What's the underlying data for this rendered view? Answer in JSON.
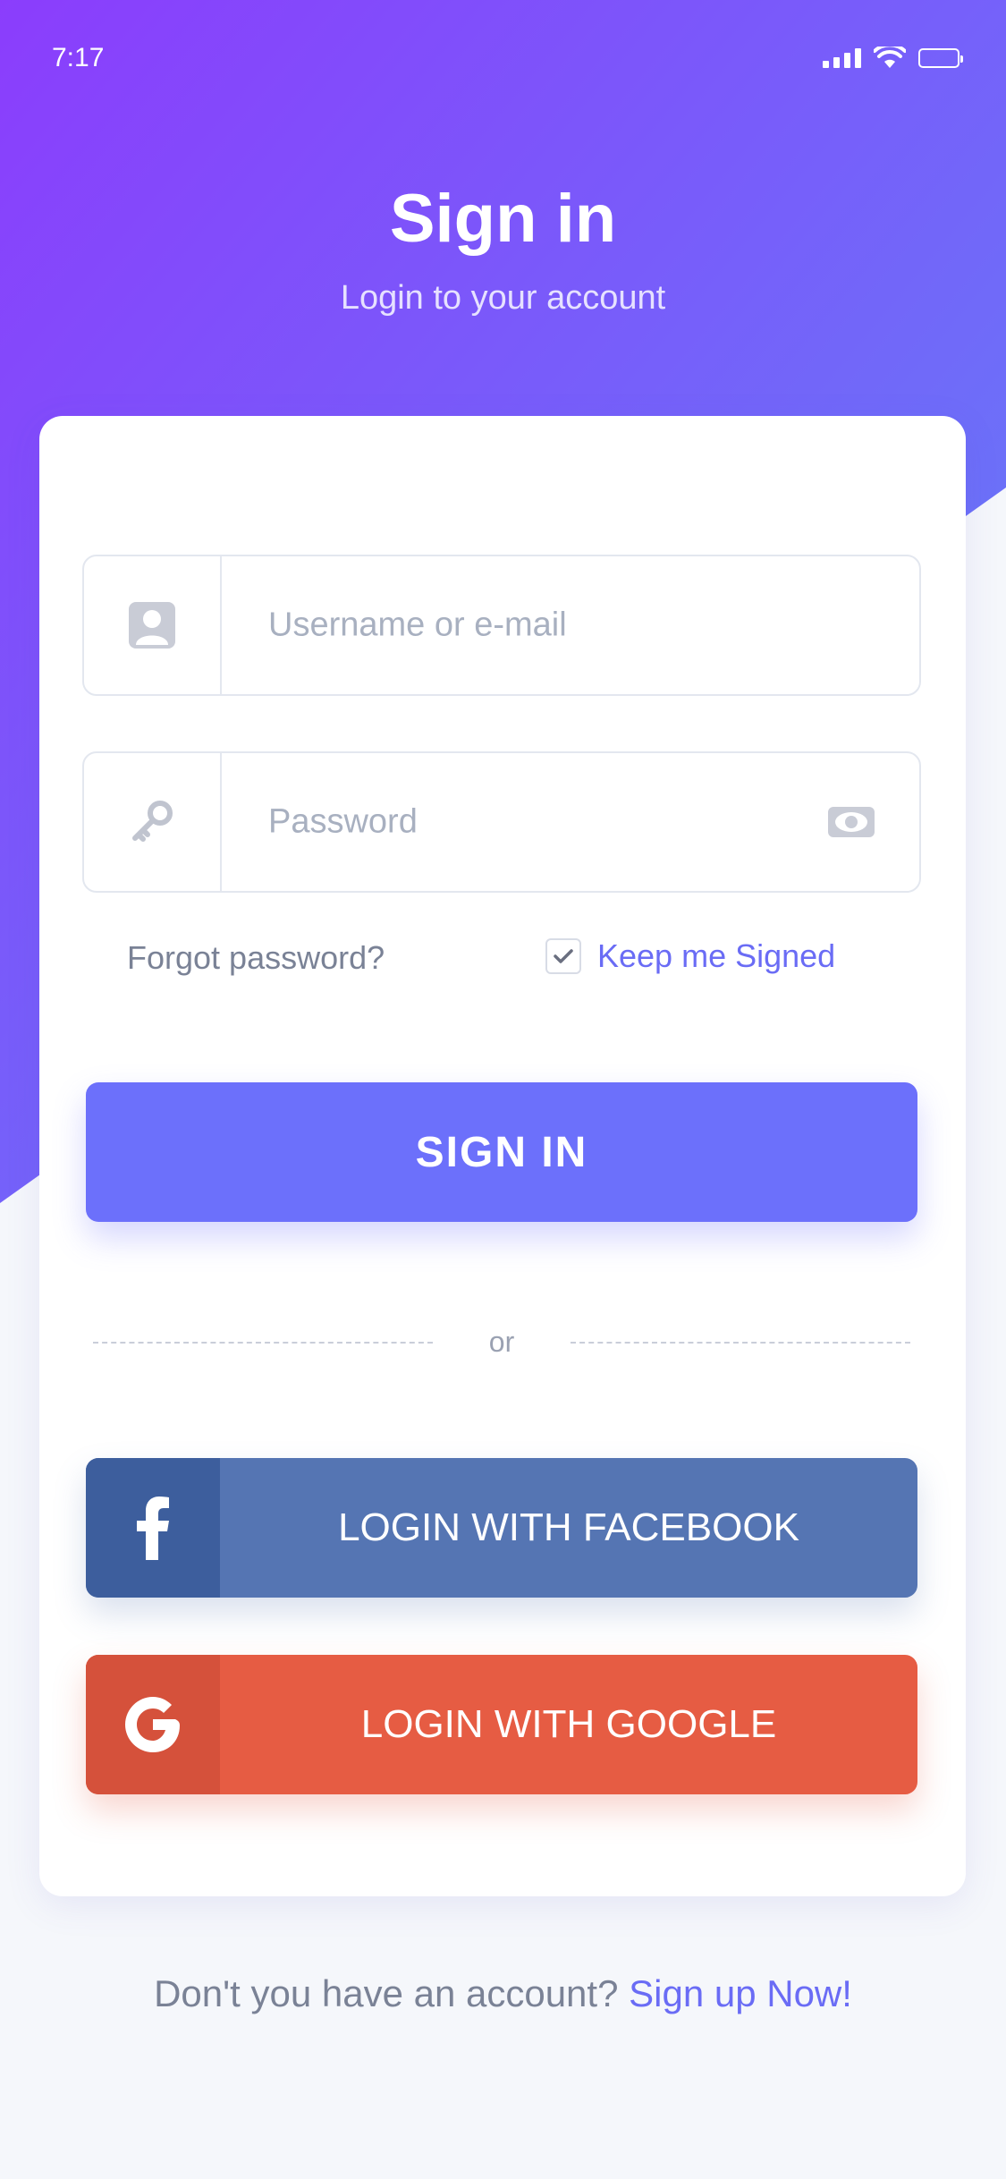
{
  "status_bar": {
    "time": "7:17"
  },
  "header": {
    "title": "Sign in",
    "subtitle": "Login to your account"
  },
  "form": {
    "username": {
      "placeholder": "Username or e-mail",
      "icon": "user-icon"
    },
    "password": {
      "placeholder": "Password",
      "icon": "key-icon",
      "toggle_icon": "eye-icon"
    },
    "forgot_label": "Forgot password?",
    "keep_signed_label": "Keep me Signed",
    "keep_signed_checked": true,
    "signin_label": "SIGN IN",
    "divider_label": "or"
  },
  "social": {
    "facebook_label": "LOGIN WITH FACEBOOK",
    "google_label": "LOGIN WITH GOOGLE"
  },
  "footer": {
    "prompt": "Don't you have an account?",
    "link": "Sign up Now!"
  },
  "colors": {
    "gradient_top": "#8a3ffc",
    "gradient_bottom": "#6a7cf8",
    "accent": "#6c70fb",
    "facebook": "#5575b3",
    "google": "#e65c43"
  }
}
